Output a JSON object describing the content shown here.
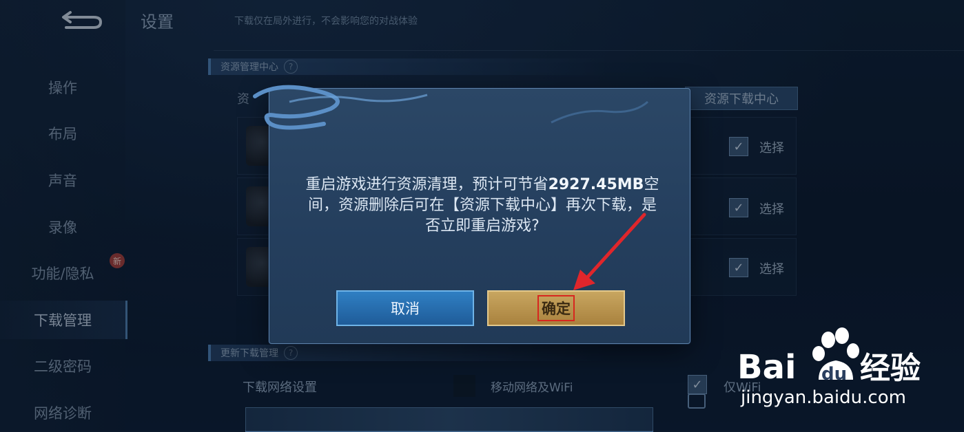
{
  "sidebar": {
    "items": [
      {
        "label": "操作"
      },
      {
        "label": "布局"
      },
      {
        "label": "声音"
      },
      {
        "label": "录像"
      },
      {
        "label": "功能/隐私"
      },
      {
        "label": "下载管理",
        "active": true
      },
      {
        "label": "二级密码"
      },
      {
        "label": "网络诊断"
      }
    ],
    "new_badge": "新"
  },
  "header": {
    "title": "设置",
    "notice": "下载仅在局外进行，不会影响您的对战体验"
  },
  "sections": {
    "resource_center": "资源管理中心",
    "update_download": "更新下载管理",
    "resource_label_partial": "资",
    "download_center_tab": "资源下载中心",
    "rows": [
      {
        "select_label": "选择",
        "checked": true
      },
      {
        "select_label": "选择",
        "checked": true
      },
      {
        "select_label": "选择",
        "checked": true
      }
    ],
    "network_setting_label": "下载网络设置",
    "network_value": "移动网络及WiFi",
    "wifi_only": "仅WiFi"
  },
  "dialog": {
    "message_line1_a": "重启游戏进行资源清理，预计可节省",
    "message_line1_size": "2927.45MB",
    "message_line1_b": "空",
    "message_line2": "间，资源删除后可在【资源下载中心】再次下载，是",
    "message_line3": "否立即重启游戏?",
    "cancel_label": "取消",
    "confirm_label": "确定"
  },
  "watermark": {
    "logo_text_a": "Bai",
    "logo_text_b": "du",
    "logo_text_c": "经验",
    "url": "jingyan.baidu.com"
  },
  "colors": {
    "cancel_button": "#2f7fc3",
    "confirm_button": "#c8a660",
    "highlight_box": "#d7261f",
    "arrow": "#e0262b"
  }
}
